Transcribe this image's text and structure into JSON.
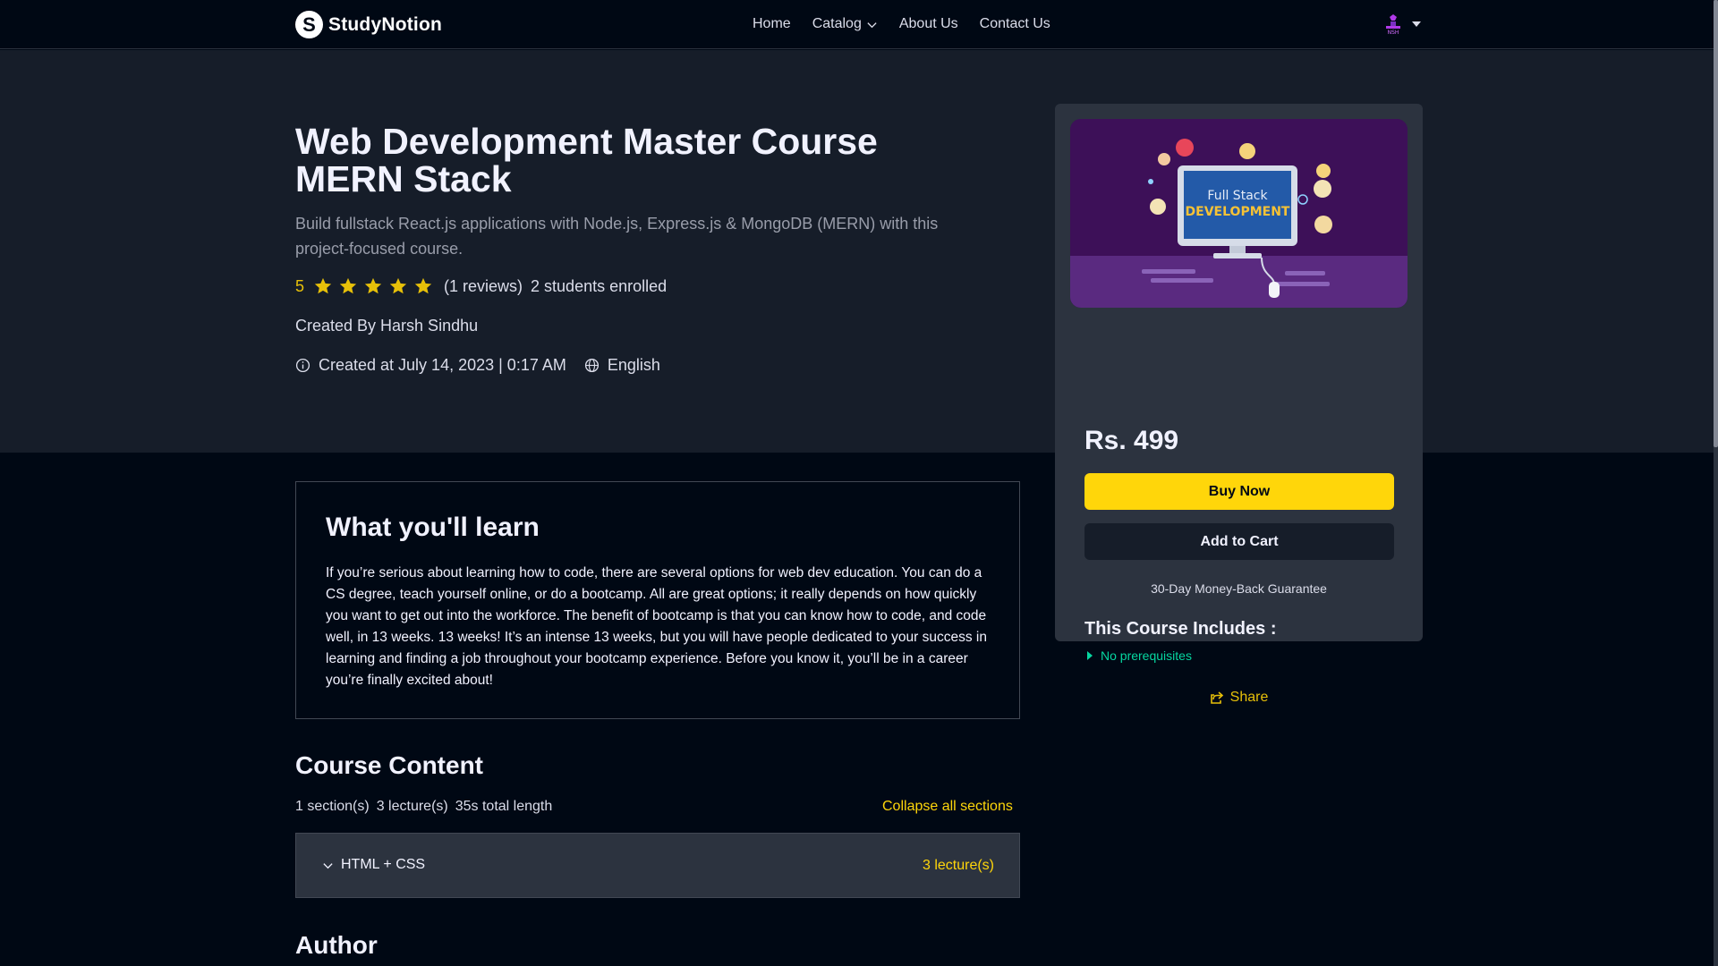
{
  "nav": {
    "brand": "StudyNotion",
    "logo_letter": "S",
    "links": [
      "Home",
      "Catalog",
      "About Us",
      "Contact Us"
    ]
  },
  "course": {
    "title": "Web Development Master Course MERN Stack",
    "description": "Build fullstack React.js applications with Node.js, Express.js & MongoDB (MERN) with this project-focused course.",
    "rating": "5",
    "stars": 5,
    "reviews": "(1 reviews)",
    "enrolled": "2 students enrolled",
    "created_by": "Created By Harsh Sindhu",
    "created_at": "Created at July 14, 2023 | 0:17 AM",
    "language": "English"
  },
  "card": {
    "thumb_line1": "Full Stack",
    "thumb_line2": "DEVELOPMENT",
    "price": "Rs. 499",
    "buy_label": "Buy Now",
    "cart_label": "Add to Cart",
    "guarantee": "30-Day Money-Back Guarantee",
    "includes_title": "This Course Includes :",
    "includes": [
      "No prerequisites"
    ],
    "share_label": "Share"
  },
  "learn": {
    "title": "What you'll learn",
    "text": "If you’re serious about learning how to code, there are several options for web dev education. You can do a CS degree, teach yourself online, or do a bootcamp. All are great options; it really depends on how quickly you want to get out into the workforce. The benefit of bootcamp is that you can know how to code, and code well, in 13 weeks. 13 weeks! It’s an intense 13 weeks, but you will have people dedicated to your success in learning and finding a job throughout your bootcamp experience. Before you know it, you’ll be in a career you’re finally excited about!"
  },
  "content": {
    "title": "Course Content",
    "sections_count": "1 section(s)",
    "lectures_count": "3 lecture(s)",
    "total_length": "35s total length",
    "collapse_label": "Collapse all sections",
    "sections": [
      {
        "name": "HTML + CSS",
        "lectures": "3 lecture(s)"
      }
    ]
  },
  "author": {
    "title": "Author"
  },
  "colors": {
    "accent_yellow": "#FFD60A",
    "star_yellow": "#E7C009",
    "green": "#06D6A0",
    "bg_dark": "#000814",
    "bg_hero": "#161D29",
    "card_bg": "#2C333F"
  }
}
